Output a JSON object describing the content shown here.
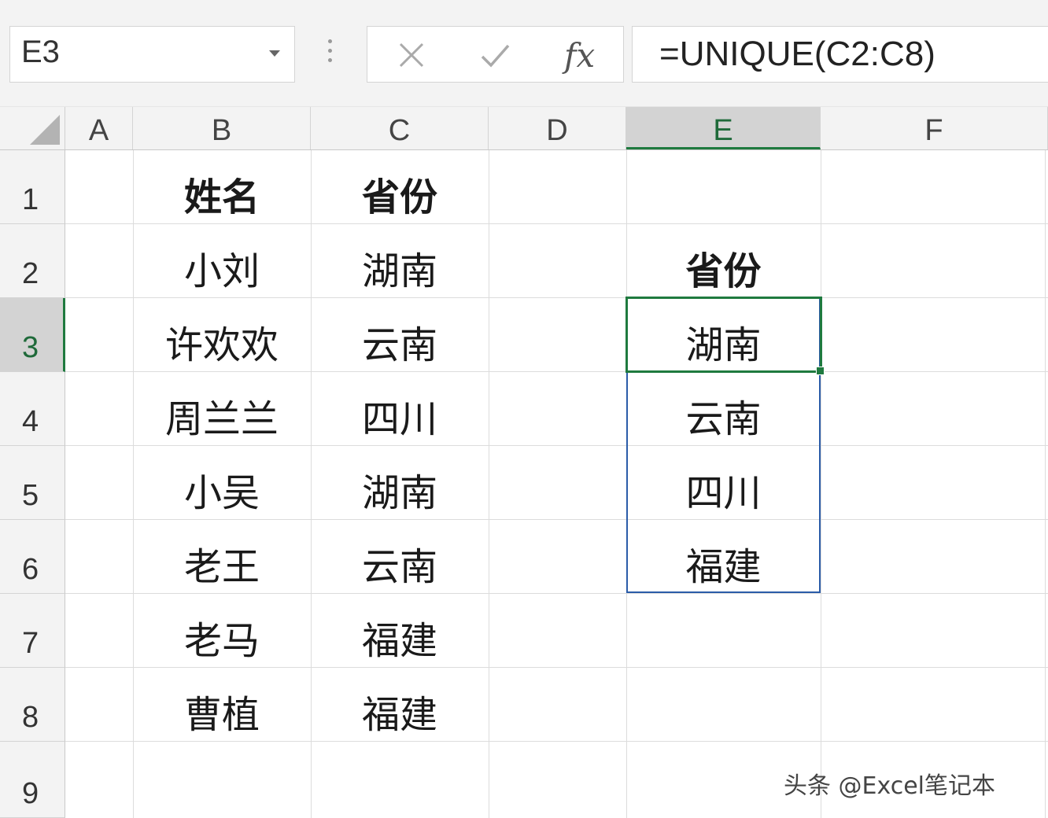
{
  "namebox": {
    "value": "E3"
  },
  "formula_bar": {
    "fx_label": "fx",
    "formula": "=UNIQUE(C2:C8)"
  },
  "columns": [
    "A",
    "B",
    "C",
    "D",
    "E",
    "F"
  ],
  "rows": [
    "1",
    "2",
    "3",
    "4",
    "5",
    "6",
    "7",
    "8",
    "9"
  ],
  "active": {
    "column": "E",
    "row": "3"
  },
  "cells": {
    "B1": "姓名",
    "C1": "省份",
    "B2": "小刘",
    "C2": "湖南",
    "B3": "许欢欢",
    "C3": "云南",
    "B4": "周兰兰",
    "C4": "四川",
    "B5": "小吴",
    "C5": "湖南",
    "B6": "老王",
    "C6": "云南",
    "B7": "老马",
    "C7": "福建",
    "B8": "曹植",
    "C8": "福建",
    "E2": "省份",
    "E3": "湖南",
    "E4": "云南",
    "E5": "四川",
    "E6": "福建"
  },
  "watermark": "头条 @Excel笔记本",
  "colors": {
    "active_green": "#1f7a3f",
    "spill_blue": "#2b5ca8"
  }
}
